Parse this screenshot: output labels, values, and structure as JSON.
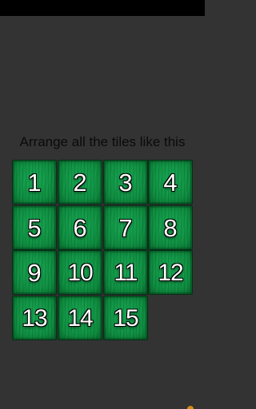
{
  "instruction": "Arrange all the tiles like this",
  "tiles": [
    "1",
    "2",
    "3",
    "4",
    "5",
    "6",
    "7",
    "8",
    "9",
    "10",
    "11",
    "12",
    "13",
    "14",
    "15"
  ],
  "colors": {
    "background": "#333333",
    "status_bar": "#000000",
    "tile": "#0f9343",
    "tile_text": "#ffffff",
    "corner_mark": "#d38a16"
  }
}
